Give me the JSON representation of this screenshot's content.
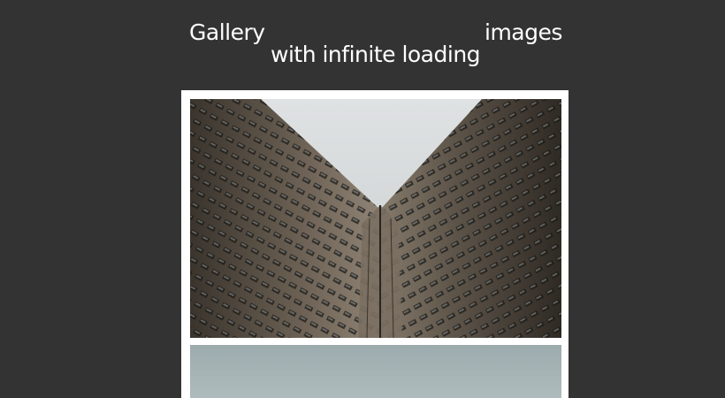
{
  "header": {
    "title_part1": "Gallery",
    "title_part2": "with infinite loading",
    "title_part3": "images"
  },
  "gallery": {
    "images": [
      {
        "subject": "low-angle view of two high-rise buildings against a pale sky"
      },
      {
        "subject": "pale blue-gray sky (partially loaded)"
      }
    ]
  },
  "colors": {
    "background": "#333333",
    "card": "#ffffff",
    "title_text": "#ffffff"
  }
}
